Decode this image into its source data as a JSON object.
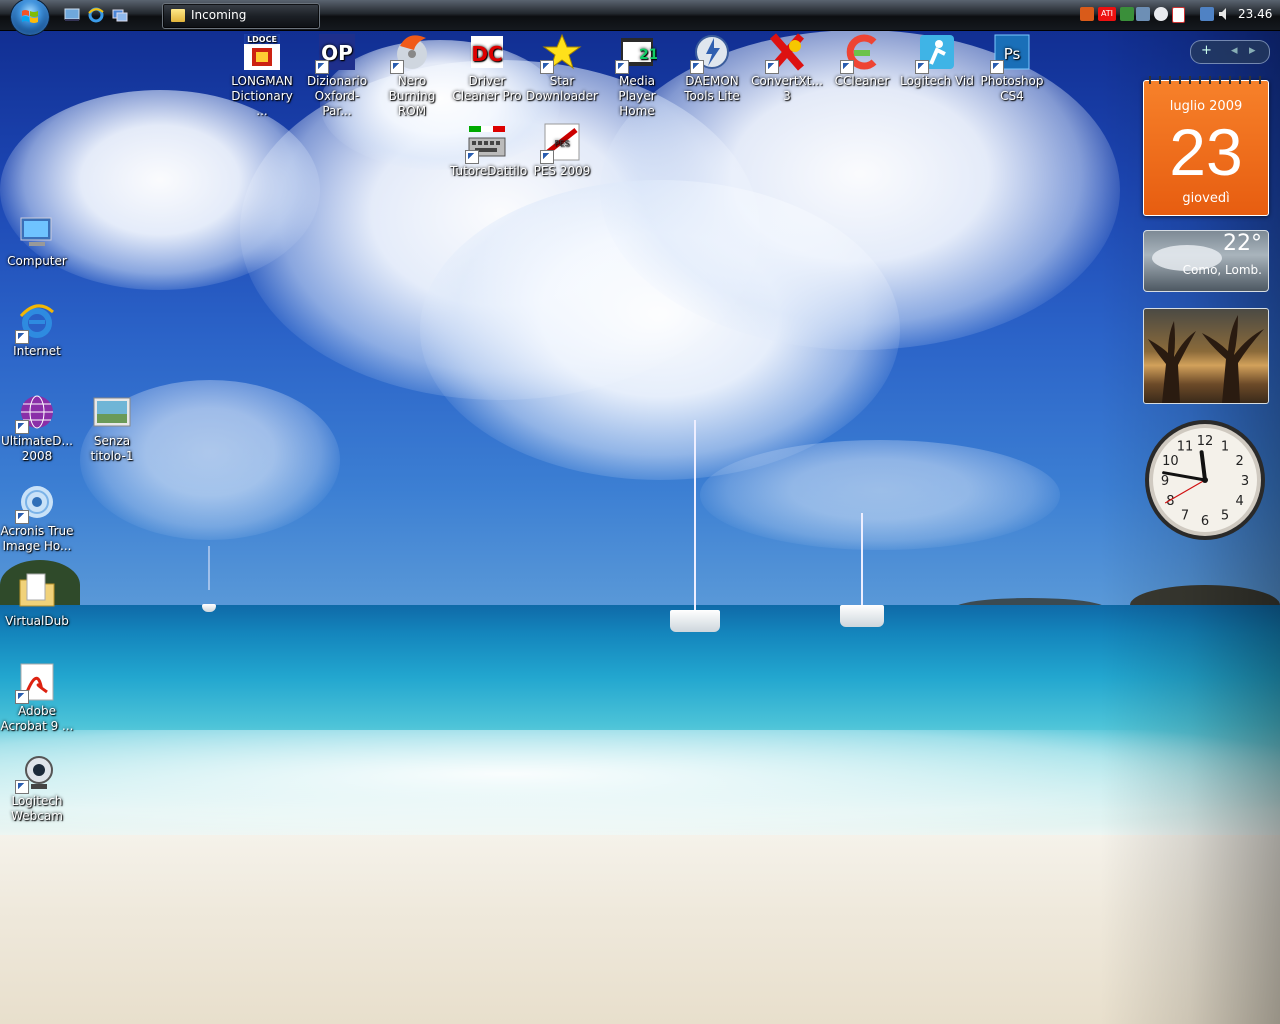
{
  "taskbar": {
    "active_task_label": "Incoming",
    "clock": "23.46"
  },
  "desktop_icons_top": [
    {
      "label": "LONGMAN Dictionary ...",
      "icon": "longman-icon",
      "badge": "LDOCE"
    },
    {
      "label": "Dizionario Oxford-Par...",
      "icon": "oxford-icon",
      "badge": "OP"
    },
    {
      "label": "Nero Burning ROM",
      "icon": "nero-icon"
    },
    {
      "label": "Driver Cleaner Pro",
      "icon": "driver-cleaner-icon",
      "badge": "DC"
    },
    {
      "label": "Star Downloader",
      "icon": "star-icon"
    },
    {
      "label": "Media Player Home",
      "icon": "media-player-icon"
    },
    {
      "label": "DAEMON Tools Lite",
      "icon": "daemon-tools-icon"
    },
    {
      "label": "ConvertXt... 3",
      "icon": "convertx-icon"
    },
    {
      "label": "CCleaner",
      "icon": "ccleaner-icon"
    },
    {
      "label": "Logitech Vid",
      "icon": "logitech-vid-icon"
    },
    {
      "label": "Photoshop CS4",
      "icon": "photoshop-icon",
      "badge": "Ps"
    }
  ],
  "desktop_icons_row2": [
    {
      "label": "TutoreDattilo",
      "icon": "keyboard-icon"
    },
    {
      "label": "PES 2009",
      "icon": "pes-icon"
    }
  ],
  "desktop_icons_left": [
    {
      "label": "Computer",
      "icon": "computer-icon"
    },
    {
      "label": "Internet",
      "icon": "internet-explorer-icon"
    },
    {
      "label": "UltimateD... 2008",
      "icon": "globe-icon"
    },
    {
      "label": "Senza titolo-1",
      "icon": "image-file-icon"
    },
    {
      "label": "Acronis True Image Ho...",
      "icon": "acronis-icon"
    },
    {
      "label": "VirtualDub",
      "icon": "folder-icon"
    },
    {
      "label": "Adobe Acrobat 9 ...",
      "icon": "acrobat-icon"
    },
    {
      "label": "Logitech Webcam",
      "icon": "webcam-icon"
    }
  ],
  "gadgets": {
    "calendar": {
      "month": "luglio 2009",
      "day": "23",
      "weekday": "giovedì"
    },
    "weather": {
      "temp": "22°",
      "location": "Como, Lomb."
    },
    "clock": {
      "hour": 11,
      "minute": 46,
      "second": 40
    }
  },
  "sidebar_controls": {
    "add": "+",
    "prev": "◂",
    "next": "▸"
  },
  "colors": {
    "calendar": "#f07020",
    "taskbar": "#15191e",
    "sky": "#1c46b3",
    "sea": "#22a6cf"
  }
}
